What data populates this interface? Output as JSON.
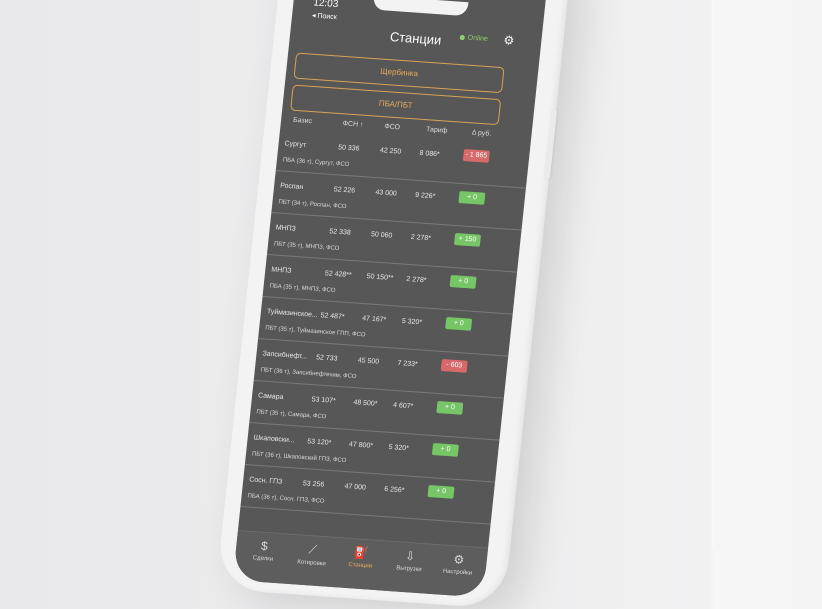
{
  "status": {
    "time": "12:03",
    "back_label": "◂ Поиск",
    "online": "Online"
  },
  "header": {
    "title": "Станции"
  },
  "selectors": [
    "Щербинка",
    "ПБА/ПБТ"
  ],
  "columns": [
    "Базис",
    "ФСН ↑",
    "ФСО",
    "Тариф",
    "Δ руб."
  ],
  "rows": [
    {
      "name": "Сургут",
      "fsn": "50 336",
      "fso": "42 250",
      "tariff": "8 086*",
      "delta": "- 1 865",
      "sign": "neg",
      "sub": "ПБА (36 т), Сургут, ФСО"
    },
    {
      "name": "Роспан",
      "fsn": "52 226",
      "fso": "43 000",
      "tariff": "9 226*",
      "delta": "+ 0",
      "sign": "pos",
      "sub": "ПБТ (34 т), Роспан, ФСО"
    },
    {
      "name": "МНПЗ",
      "fsn": "52 338",
      "fso": "50 060",
      "tariff": "2 278*",
      "delta": "+ 150",
      "sign": "pos",
      "sub": "ПБТ (35 т), МНПЗ, ФСО"
    },
    {
      "name": "МНПЗ",
      "fsn": "52 428**",
      "fso": "50 150**",
      "tariff": "2 278*",
      "delta": "+ 0",
      "sign": "pos",
      "sub": "ПБА (35 т), МНПЗ, ФСО"
    },
    {
      "name": "Туймазинское...",
      "fsn": "52 487*",
      "fso": "47 167*",
      "tariff": "5 320*",
      "delta": "+ 0",
      "sign": "pos",
      "sub": "ПБТ (35 т), Туймазинское ГПП, ФСО"
    },
    {
      "name": "Запсибнефт...",
      "fsn": "52 733",
      "fso": "45 500",
      "tariff": "7 233*",
      "delta": "- 603",
      "sign": "neg",
      "sub": "ПБТ (36 т), Запсибнефтехим, ФСО"
    },
    {
      "name": "Самара",
      "fsn": "53 107*",
      "fso": "48 500*",
      "tariff": "4 607*",
      "delta": "+ 0",
      "sign": "pos",
      "sub": "ПБТ (35 т), Самара, ФСО"
    },
    {
      "name": "Шкаповски...",
      "fsn": "53 120*",
      "fso": "47 800*",
      "tariff": "5 320*",
      "delta": "+ 0",
      "sign": "pos",
      "sub": "ПБТ (36 т), Шкаповский ГПЗ, ФСО"
    },
    {
      "name": "Сосн. ГПЗ",
      "fsn": "53 256",
      "fso": "47 000",
      "tariff": "6 256*",
      "delta": "+ 0",
      "sign": "pos",
      "sub": "ПБА (36 т), Сосн. ГПЗ, ФСО"
    }
  ],
  "tabs": [
    {
      "label": "Сделки",
      "icon": "deals-icon",
      "glyph": "$"
    },
    {
      "label": "Котировки",
      "icon": "chart-icon",
      "glyph": "⟋"
    },
    {
      "label": "Станции",
      "icon": "fuel-icon",
      "glyph": "⛽",
      "active": true
    },
    {
      "label": "Выгрузки",
      "icon": "unload-icon",
      "glyph": "⇩"
    },
    {
      "label": "Настройки",
      "icon": "settings-icon",
      "glyph": "⚙"
    }
  ],
  "colors": {
    "accent": "#e7a95a",
    "positive": "#76c566",
    "negative": "#d8696a",
    "screen_bg": "#575757"
  }
}
